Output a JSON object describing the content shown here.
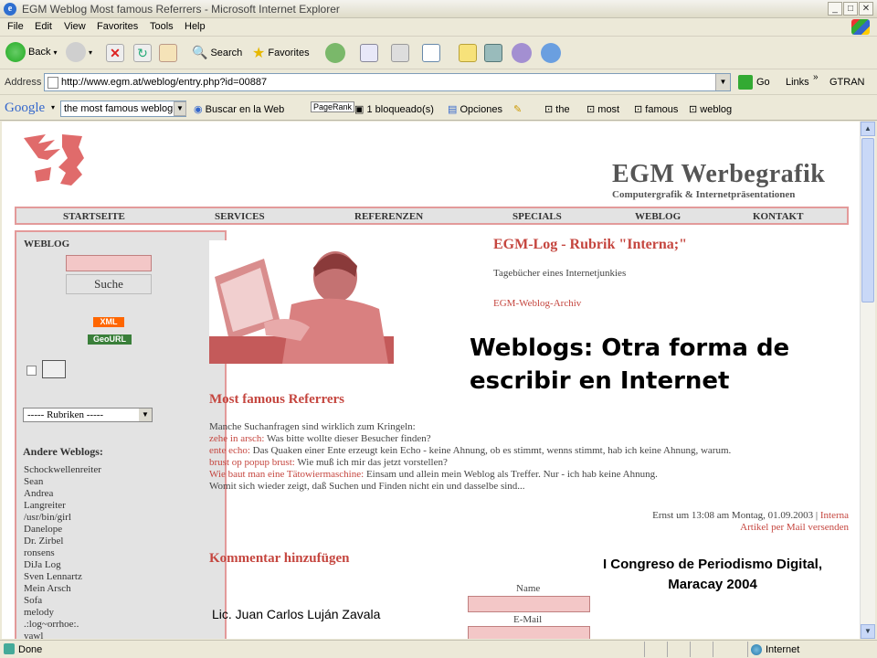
{
  "window": {
    "title": "EGM Weblog Most famous Referrers - Microsoft Internet Explorer"
  },
  "menu": [
    "File",
    "Edit",
    "View",
    "Favorites",
    "Tools",
    "Help"
  ],
  "toolbar": {
    "back": "Back",
    "search": "Search",
    "favorites": "Favorites"
  },
  "address": {
    "label": "Address",
    "url": "http://www.egm.at/weblog/entry.php?id=00887",
    "go": "Go",
    "links": "Links",
    "gtran": "GTRAN"
  },
  "googlebar": {
    "logo": "Google",
    "query": "the most famous weblog",
    "search_web": "Buscar en la Web",
    "pagerank": "PageRank",
    "blocked": "1 bloqueado(s)",
    "options": "Opciones",
    "terms": [
      "the",
      "most",
      "famous",
      "weblog"
    ]
  },
  "page": {
    "brand": {
      "name": "EGM Werbegrafik",
      "tagline": "Computergrafik & Internetpräsentationen"
    },
    "nav": [
      "STARTSEITE",
      "SERVICES",
      "REFERENZEN",
      "SPECIALS",
      "WEBLOG",
      "KONTAKT"
    ],
    "sidebar": {
      "heading": "WEBLOG",
      "search_button": "Suche",
      "xml_badge": "XML",
      "geourl_badge": "GeoURL",
      "rubriken_select": "----- Rubriken -----",
      "other_heading": "Andere Weblogs:",
      "weblogs": [
        "Schockwellenreiter",
        "Sean",
        "Andrea",
        "Langreiter",
        "/usr/bin/girl",
        "Danelope",
        "Dr. Zirbel",
        "ronsens",
        "DiJa Log",
        "Sven Lennartz",
        "Mein Arsch",
        "Sofa",
        "melody",
        ".:log~orrhoe:.",
        "yawl"
      ]
    },
    "header": {
      "title": "EGM-Log - Rubrik \"Interna;\"",
      "subtitle": "Tagebücher eines Internetjunkies",
      "archive": "EGM-Weblog-Archiv"
    },
    "referrers": {
      "heading": "Most famous Referrers",
      "intro": "Manche Suchanfragen sind wirklich zum Kringeln:",
      "items": [
        {
          "term": "zehe in arsch:",
          "text": " Was bitte wollte dieser Besucher finden?"
        },
        {
          "term": "ente echo:",
          "text": " Das Quaken einer Ente erzeugt kein Echo - keine Ahnung, ob es stimmt, wenns stimmt, hab ich keine Ahnung, warum."
        },
        {
          "term": "brust op popup brust:",
          "text": " Wie muß ich mir das jetzt vorstellen?"
        },
        {
          "term": "Wie baut man eine Tätowiermaschine:",
          "text": " Einsam und allein mein Weblog als Treffer. Nur - ich hab keine Ahnung."
        }
      ],
      "closing": "Womit sich wieder zeigt, daß Suchen und Finden nicht ein und dasselbe sind...",
      "meta": "Ernst um 13:08 am Montag, 01.09.2003 |",
      "meta_link": "Interna",
      "mail_link": "Artikel per Mail versenden"
    },
    "comment": {
      "heading": "Kommentar hinzufügen",
      "name_label": "Name",
      "email_label": "E-Mail"
    }
  },
  "overlay": {
    "headline_line1": "Weblogs: Otra forma de",
    "headline_line2": "escribir  en Internet",
    "congress_line1": "I Congreso de Periodismo Digital,",
    "congress_line2": "Maracay 2004",
    "author": "Lic. Juan Carlos Luján Zavala"
  },
  "status": {
    "text": "Done",
    "zone": "Internet"
  }
}
